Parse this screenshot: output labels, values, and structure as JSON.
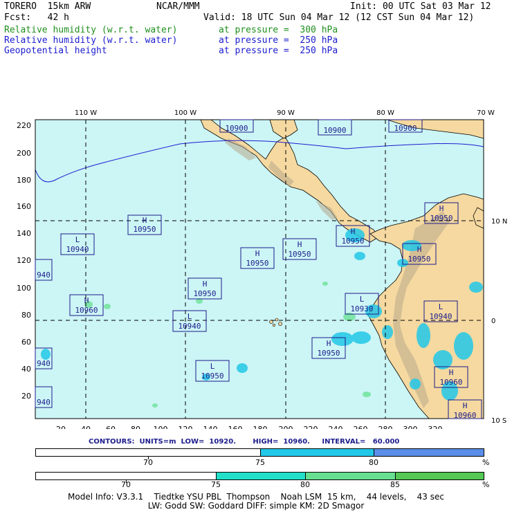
{
  "header": {
    "model": "TORERO  15km ARW",
    "center": "NCAR/MMM",
    "init": "Init: 00 UTC Sat 03 Mar 12",
    "fcst": "Fcst:   42 h",
    "valid": "Valid: 18 UTC Sun 04 Mar 12 (12 CST Sun 04 Mar 12)",
    "fields": [
      {
        "name": "Relative humidity (w.r.t. water)",
        "level": "at pressure =  300 hPa",
        "color": "#1e8f1e"
      },
      {
        "name": "Relative humidity (w.r.t. water)",
        "level": "at pressure =  250 hPa",
        "color": "#1c1cd0"
      },
      {
        "name": "Geopotential height",
        "level": "at pressure =  250 hPa",
        "color": "#1c1cd0"
      }
    ]
  },
  "map": {
    "lon_labels": [
      "110 W",
      "100 W",
      "90 W",
      "80 W",
      "70 W"
    ],
    "lat_labels": [
      "10 N",
      "0",
      "10 S"
    ],
    "x_ticks": [
      "20",
      "40",
      "60",
      "80",
      "100",
      "120",
      "140",
      "160",
      "180",
      "200",
      "220",
      "240",
      "260",
      "280",
      "300",
      "320"
    ],
    "y_ticks": [
      "220",
      "200",
      "180",
      "160",
      "140",
      "120",
      "100",
      "80",
      "60",
      "40",
      "20"
    ],
    "ocean_color": "#ccf5f5",
    "land_color": "#f5d9a0",
    "pressure_centers": [
      {
        "type": "H",
        "value": "10900"
      },
      {
        "type": "H",
        "value": "10900"
      },
      {
        "type": "",
        "value": "10900"
      },
      {
        "type": "H",
        "value": "10950"
      },
      {
        "type": "L",
        "value": "10940"
      },
      {
        "type": "H",
        "value": "10950"
      },
      {
        "type": "H",
        "value": "10950"
      },
      {
        "type": "H",
        "value": "10950"
      },
      {
        "type": "H",
        "value": "10950"
      },
      {
        "type": "H",
        "value": "10950"
      },
      {
        "type": "",
        "value": "940"
      },
      {
        "type": "H",
        "value": "10950"
      },
      {
        "type": "L",
        "value": "10930"
      },
      {
        "type": "H",
        "value": "10960"
      },
      {
        "type": "L",
        "value": "10940"
      },
      {
        "type": "L",
        "value": "10940"
      },
      {
        "type": "H",
        "value": "10950"
      },
      {
        "type": "",
        "value": "940"
      },
      {
        "type": "L",
        "value": "10950"
      },
      {
        "type": "H",
        "value": "10960"
      },
      {
        "type": "",
        "value": "940"
      },
      {
        "type": "H",
        "value": "10960"
      }
    ]
  },
  "contours": {
    "text": "CONTOURS:  UNITS=m  LOW=  10920.       HIGH=  10960.     INTERVAL=   60.000"
  },
  "colorbar_blue": {
    "labels": [
      "70",
      "75",
      "80"
    ],
    "unit": "%",
    "colors": [
      "#ffffff",
      "#22c8e8",
      "#5a8ee8"
    ]
  },
  "colorbar_green": {
    "labels": [
      "70",
      "75",
      "80",
      "85"
    ],
    "unit": "%",
    "colors": [
      "#ffffff",
      "#22e0c8",
      "#66e090",
      "#55c855"
    ]
  },
  "footer": {
    "line1": "Model Info: V3.3.1    Tiedtke YSU PBL  Thompson    Noah LSM  15 km,    44 levels,    43 sec",
    "line2": "LW: Godd SW: Goddard DIFF: simple KM: 2D Smagor"
  }
}
